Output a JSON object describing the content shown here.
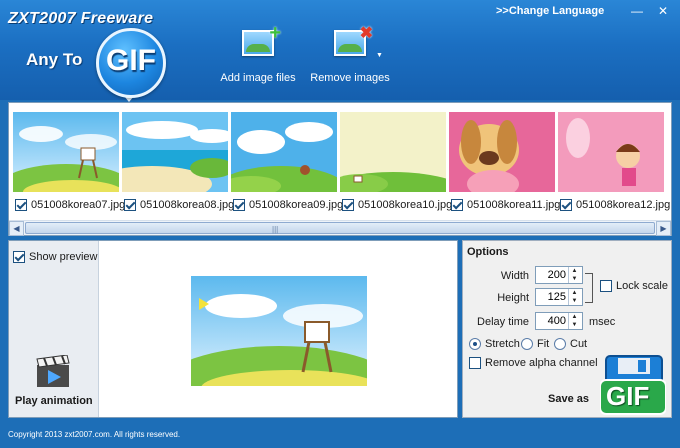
{
  "header": {
    "brand": "ZXT2007 Freeware",
    "app_name": "Any To",
    "gif_badge": "GIF",
    "change_language": ">>Change Language",
    "window_buttons": {
      "minimize": "—",
      "close": "✕"
    },
    "add_images_label": "Add image files",
    "remove_images_label": "Remove images"
  },
  "thumbnails": [
    {
      "name": "051008korea07.jpg",
      "checked": true
    },
    {
      "name": "051008korea08.jpg",
      "checked": true
    },
    {
      "name": "051008korea09.jpg",
      "checked": true
    },
    {
      "name": "051008korea10.jpg",
      "checked": true
    },
    {
      "name": "051008korea11.jpg",
      "checked": true
    },
    {
      "name": "051008korea12.jpg",
      "checked": true
    }
  ],
  "scrollbar": {
    "left_arrow": "◀",
    "right_arrow": "▶",
    "grip": "|||"
  },
  "preview": {
    "show_preview_label": "Show preview",
    "show_preview_checked": true,
    "play_animation_label": "Play animation"
  },
  "options": {
    "title": "Options",
    "width_label": "Width",
    "width_value": "200",
    "height_label": "Height",
    "height_value": "125",
    "lock_scale_label": "Lock scale",
    "lock_scale_checked": false,
    "delay_label": "Delay time",
    "delay_value": "400",
    "delay_unit": "msec",
    "fit_modes": [
      "Stretch",
      "Fit",
      "Cut"
    ],
    "selected_fit": "Stretch",
    "remove_alpha_label": "Remove alpha channel",
    "remove_alpha_checked": false,
    "save_as_label": "Save as",
    "save_badge": "GIF"
  },
  "footer": {
    "copyright": "Copyright 2013 zxt2007.com. All rights reserved."
  },
  "colors": {
    "header_blue": "#1d6eb7",
    "accent": "#1d86e0",
    "panel_border": "#7f9db9"
  }
}
